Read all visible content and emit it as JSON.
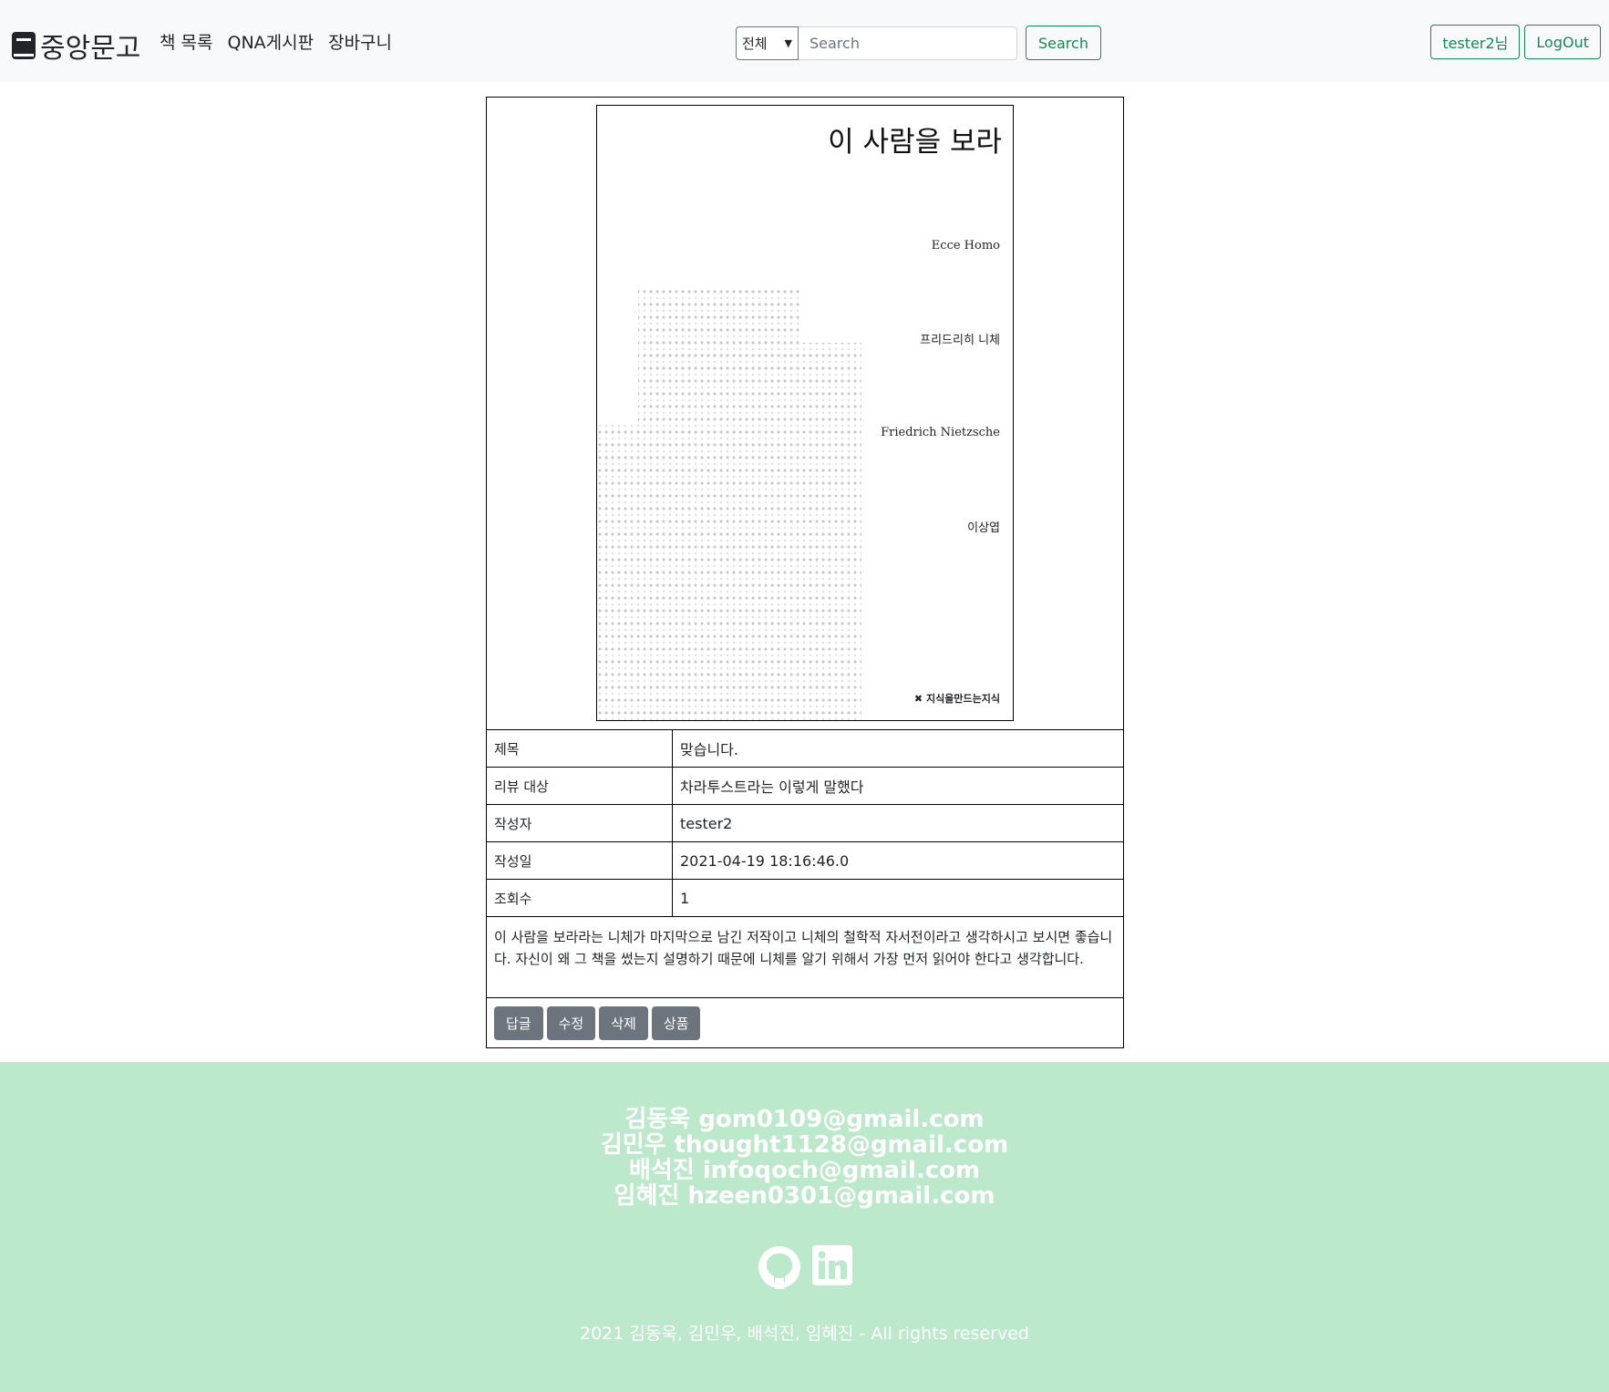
{
  "nav": {
    "brand": "중앙문고",
    "links": [
      "책 목록",
      "QNA게시판",
      "장바구니"
    ],
    "search_select": "전체",
    "search_placeholder": "Search",
    "search_button": "Search",
    "user_button": "tester2님",
    "logout_button": "LogOut"
  },
  "cover": {
    "title": "이 사람을 보라",
    "subtitle": "Ecce Homo",
    "author_kr": "프리드리히 니체",
    "author_en": "Friedrich Nietzsche",
    "translator": "이상엽",
    "publisher": "지식을만드는지식"
  },
  "review": {
    "rows": [
      {
        "label": "제목",
        "value": "맞습니다."
      },
      {
        "label": "리뷰 대상",
        "value": "차라투스트라는 이렇게 말했다"
      },
      {
        "label": "작성자",
        "value": "tester2"
      },
      {
        "label": "작성일",
        "value": "2021-04-19 18:16:46.0"
      },
      {
        "label": "조회수",
        "value": "1"
      }
    ],
    "body": "이 사람을 보라라는 니체가 마지막으로 남긴 저작이고 니체의 철학적 자서전이라고 생각하시고 보시면 좋습니다. 자신이 왜 그 책을 썼는지 설명하기 때문에 니체를 알기 위해서 가장 먼저 읽어야 한다고 생각합니다.",
    "buttons": [
      "답글",
      "수정",
      "삭제",
      "상품"
    ]
  },
  "footer": {
    "contacts": [
      "김동욱 gom0109@gmail.com",
      "김민우 thought1128@gmail.com",
      "배석진 infoqoch@gmail.com",
      "임혜진 hzeen0301@gmail.com"
    ],
    "social_icons": [
      "github-icon",
      "linkedin-icon"
    ],
    "copyright": "2021 김동욱, 김민우, 배석진, 임혜진 - All rights reserved"
  },
  "colors": {
    "accent": "#198754",
    "button_secondary": "#6c757d",
    "footer_bg": "#bce8cb",
    "navbar_bg": "#f8f9fa"
  }
}
